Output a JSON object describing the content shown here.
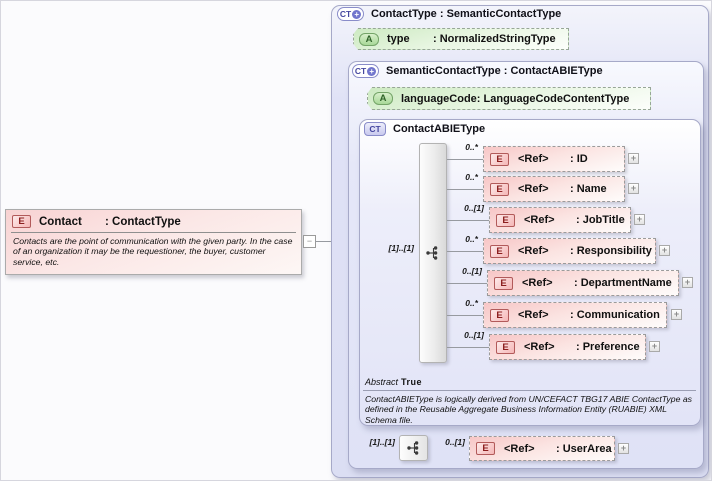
{
  "colors": {
    "element_pink": "#f7c6c6",
    "attribute_green": "#cdeac2",
    "panel_lavender": "#dfe2f6",
    "connector_gray": "#979aa0",
    "type_icon_purple": "#45479f"
  },
  "contact": {
    "icon": "E",
    "name": "Contact",
    "type": ": ContactType",
    "annotation": "Contacts are the point of communication with the given party. In the case of an organization it may be the requestioner, the buyer, customer service, etc.",
    "collapse_glyph": "−"
  },
  "contact_type_panel": {
    "icon": "CT",
    "icon_plus": "+",
    "title": "ContactType : SemanticContactType",
    "attribute": {
      "icon": "A",
      "name": "type",
      "type": ": NormalizedStringType"
    }
  },
  "semantic_panel": {
    "icon": "CT",
    "icon_plus": "+",
    "title": "SemanticContactType : ContactABIEType",
    "attribute": {
      "icon": "A",
      "name": "languageCode",
      "type": ": LanguageCodeContentType"
    }
  },
  "abie_panel": {
    "icon": "CT",
    "title": "ContactABIEType",
    "model_cardinality": "[1]..[1]",
    "children": [
      {
        "cardinality": "0..*",
        "icon": "E",
        "name": "<Ref>",
        "type": ": ID",
        "expand": "+"
      },
      {
        "cardinality": "0..*",
        "icon": "E",
        "name": "<Ref>",
        "type": ": Name",
        "expand": "+"
      },
      {
        "cardinality": "0..[1]",
        "icon": "E",
        "name": "<Ref>",
        "type": ": JobTitle",
        "expand": "+"
      },
      {
        "cardinality": "0..*",
        "icon": "E",
        "name": "<Ref>",
        "type": ": Responsibility",
        "expand": "+"
      },
      {
        "cardinality": "0..[1]",
        "icon": "E",
        "name": "<Ref>",
        "type": ": DepartmentName",
        "expand": "+"
      },
      {
        "cardinality": "0..*",
        "icon": "E",
        "name": "<Ref>",
        "type": ": Communication",
        "expand": "+"
      },
      {
        "cardinality": "0..[1]",
        "icon": "E",
        "name": "<Ref>",
        "type": ": Preference",
        "expand": "+"
      }
    ],
    "abstract_label": "Abstract",
    "abstract_value": "True",
    "annotation": "ContactABIEType is logically derived from UN/CEFACT TBG17 ABIE ContactType as defined in the Reusable Aggregate Business Information Entity (RUABIE) XML Schema file."
  },
  "user_area": {
    "model_cardinality": "[1]..[1]",
    "cardinality": "0..[1]",
    "icon": "E",
    "name": "<Ref>",
    "type": ": UserArea",
    "expand": "+"
  }
}
